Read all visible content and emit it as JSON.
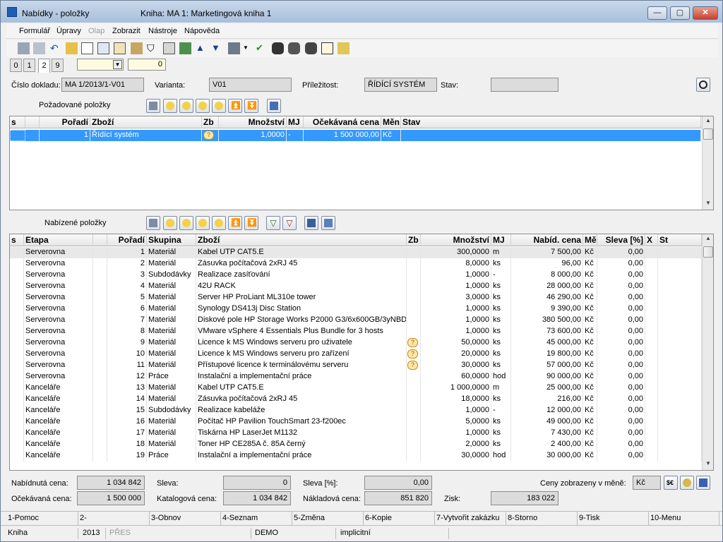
{
  "window": {
    "title": "Nabídky - položky",
    "book": "Kniha: MA 1: Marketingová kniha 1"
  },
  "menu": [
    "Formulář",
    "Úpravy",
    "Olap",
    "Zobrazit",
    "Nástroje",
    "Nápověda"
  ],
  "tabs": [
    "0",
    "1",
    "2",
    "9"
  ],
  "tab_counter": "0",
  "header": {
    "doc_label": "Číslo dokladu:",
    "doc_value": "MA 1/2013/1-V01",
    "variant_label": "Varianta:",
    "variant_value": "V01",
    "opportunity_label": "Příležitost:",
    "opportunity_value": "ŘÍDÍCÍ SYSTÉM",
    "state_label": "Stav:",
    "state_value": ""
  },
  "requested": {
    "title": "Požadované položky",
    "columns": [
      "s",
      "",
      "Pořadí",
      "Zboží",
      "Zb",
      "Množství",
      "MJ",
      "Očekávaná cena",
      "Měn",
      "Stav"
    ],
    "rows": [
      {
        "poradi": "1",
        "zbozi": "Řídící systém",
        "mnozstvi": "1,0000",
        "mj": "-",
        "cena": "1 500 000,00",
        "men": "Kč"
      }
    ]
  },
  "offered": {
    "title": "Nabízené položky",
    "columns": [
      "s",
      "Etapa",
      "Pořadí",
      "Skupina",
      "Zboží",
      "Zb",
      "Množství",
      "MJ",
      "Nabíd. cena",
      "Mě",
      "Sleva [%]",
      "X",
      "St"
    ],
    "rows": [
      {
        "etapa": "Serverovna",
        "poradi": "1",
        "skupina": "Materiál",
        "zbozi": "Kabel UTP CAT5.E",
        "zb": false,
        "mnozstvi": "300,0000",
        "mj": "m",
        "cena": "7 500,00",
        "men": "Kč",
        "sleva": "0,00"
      },
      {
        "etapa": "Serverovna",
        "poradi": "2",
        "skupina": "Materiál",
        "zbozi": "Zásuvka počítačová 2xRJ 45",
        "zb": false,
        "mnozstvi": "8,0000",
        "mj": "ks",
        "cena": "96,00",
        "men": "Kč",
        "sleva": "0,00"
      },
      {
        "etapa": "Serverovna",
        "poradi": "3",
        "skupina": "Subdodávky",
        "zbozi": "Realizace zasíťování",
        "zb": false,
        "mnozstvi": "1,0000",
        "mj": "-",
        "cena": "8 000,00",
        "men": "Kč",
        "sleva": "0,00"
      },
      {
        "etapa": "Serverovna",
        "poradi": "4",
        "skupina": "Materiál",
        "zbozi": "42U RACK",
        "zb": false,
        "mnozstvi": "1,0000",
        "mj": "ks",
        "cena": "28 000,00",
        "men": "Kč",
        "sleva": "0,00"
      },
      {
        "etapa": "Serverovna",
        "poradi": "5",
        "skupina": "Materiál",
        "zbozi": "Server HP ProLiant ML310e tower",
        "zb": false,
        "mnozstvi": "3,0000",
        "mj": "ks",
        "cena": "46 290,00",
        "men": "Kč",
        "sleva": "0,00"
      },
      {
        "etapa": "Serverovna",
        "poradi": "6",
        "skupina": "Materiál",
        "zbozi": "Synology DS413j Disc Station",
        "zb": false,
        "mnozstvi": "1,0000",
        "mj": "ks",
        "cena": "9 390,00",
        "men": "Kč",
        "sleva": "0,00"
      },
      {
        "etapa": "Serverovna",
        "poradi": "7",
        "skupina": "Materiál",
        "zbozi": "Diskové pole HP Storage Works P2000 G3/6x600GB/3yNBD",
        "zb": false,
        "mnozstvi": "1,0000",
        "mj": "ks",
        "cena": "380 500,00",
        "men": "Kč",
        "sleva": "0,00"
      },
      {
        "etapa": "Serverovna",
        "poradi": "8",
        "skupina": "Materiál",
        "zbozi": "VMware vSphere 4 Essentials Plus Bundle for 3 hosts",
        "zb": false,
        "mnozstvi": "1,0000",
        "mj": "ks",
        "cena": "73 600,00",
        "men": "Kč",
        "sleva": "0,00"
      },
      {
        "etapa": "Serverovna",
        "poradi": "9",
        "skupina": "Materiál",
        "zbozi": "Licence k MS Windows serveru pro uživatele",
        "zb": true,
        "mnozstvi": "50,0000",
        "mj": "ks",
        "cena": "45 000,00",
        "men": "Kč",
        "sleva": "0,00"
      },
      {
        "etapa": "Serverovna",
        "poradi": "10",
        "skupina": "Materiál",
        "zbozi": "Licence k MS Windows serveru pro zařízení",
        "zb": true,
        "mnozstvi": "20,0000",
        "mj": "ks",
        "cena": "19 800,00",
        "men": "Kč",
        "sleva": "0,00"
      },
      {
        "etapa": "Serverovna",
        "poradi": "11",
        "skupina": "Materiál",
        "zbozi": "Přístupové licence k terminálovému serveru",
        "zb": true,
        "mnozstvi": "30,0000",
        "mj": "ks",
        "cena": "57 000,00",
        "men": "Kč",
        "sleva": "0,00"
      },
      {
        "etapa": "Serverovna",
        "poradi": "12",
        "skupina": "Práce",
        "zbozi": "Instalační a implementační práce",
        "zb": false,
        "mnozstvi": "60,0000",
        "mj": "hod",
        "cena": "90 000,00",
        "men": "Kč",
        "sleva": "0,00"
      },
      {
        "etapa": "Kanceláře",
        "poradi": "13",
        "skupina": "Materiál",
        "zbozi": "Kabel UTP CAT5.E",
        "zb": false,
        "mnozstvi": "1 000,0000",
        "mj": "m",
        "cena": "25 000,00",
        "men": "Kč",
        "sleva": "0,00"
      },
      {
        "etapa": "Kanceláře",
        "poradi": "14",
        "skupina": "Materiál",
        "zbozi": "Zásuvka počítačová 2xRJ 45",
        "zb": false,
        "mnozstvi": "18,0000",
        "mj": "ks",
        "cena": "216,00",
        "men": "Kč",
        "sleva": "0,00"
      },
      {
        "etapa": "Kanceláře",
        "poradi": "15",
        "skupina": "Subdodávky",
        "zbozi": "Realizace kabeláže",
        "zb": false,
        "mnozstvi": "1,0000",
        "mj": "-",
        "cena": "12 000,00",
        "men": "Kč",
        "sleva": "0,00"
      },
      {
        "etapa": "Kanceláře",
        "poradi": "16",
        "skupina": "Materiál",
        "zbozi": "Počítač HP Pavilion TouchSmart 23-f200ec",
        "zb": false,
        "mnozstvi": "5,0000",
        "mj": "ks",
        "cena": "49 000,00",
        "men": "Kč",
        "sleva": "0,00"
      },
      {
        "etapa": "Kanceláře",
        "poradi": "17",
        "skupina": "Materiál",
        "zbozi": "Tiskárna HP LaserJet M1132",
        "zb": false,
        "mnozstvi": "1,0000",
        "mj": "ks",
        "cena": "7 430,00",
        "men": "Kč",
        "sleva": "0,00"
      },
      {
        "etapa": "Kanceláře",
        "poradi": "18",
        "skupina": "Materiál",
        "zbozi": "Toner HP CE285A č. 85A černý",
        "zb": false,
        "mnozstvi": "2,0000",
        "mj": "ks",
        "cena": "2 400,00",
        "men": "Kč",
        "sleva": "0,00"
      },
      {
        "etapa": "Kanceláře",
        "poradi": "19",
        "skupina": "Práce",
        "zbozi": "Instalační a implementační práce",
        "zb": false,
        "mnozstvi": "30,0000",
        "mj": "hod",
        "cena": "30 000,00",
        "men": "Kč",
        "sleva": "0,00"
      }
    ]
  },
  "totals": {
    "offered_label": "Nabídnutá cena:",
    "offered_value": "1 034 842",
    "discount_label": "Sleva:",
    "discount_value": "0",
    "discount_pct_label": "Sleva [%]:",
    "discount_pct_value": "0,00",
    "currency_label": "Ceny zobrazeny v měně:",
    "currency_value": "Kč",
    "expected_label": "Očekávaná cena:",
    "expected_value": "1 500 000",
    "catalog_label": "Katalogová cena:",
    "catalog_value": "1 034 842",
    "cost_label": "Nákladová cena:",
    "cost_value": "851 820",
    "profit_label": "Zisk:",
    "profit_value": "183 022"
  },
  "fkeys": [
    "1-Pomoc",
    "2-",
    "3-Obnov",
    "4-Seznam",
    "5-Změna",
    "6-Kopie",
    "7-Vytvořit zakázku",
    "8-Storno",
    "9-Tisk",
    "10-Menu"
  ],
  "status": {
    "module": "Kniha",
    "year": "2013",
    "mode": "PŘES",
    "db": "DEMO",
    "profile": "implicitní"
  }
}
